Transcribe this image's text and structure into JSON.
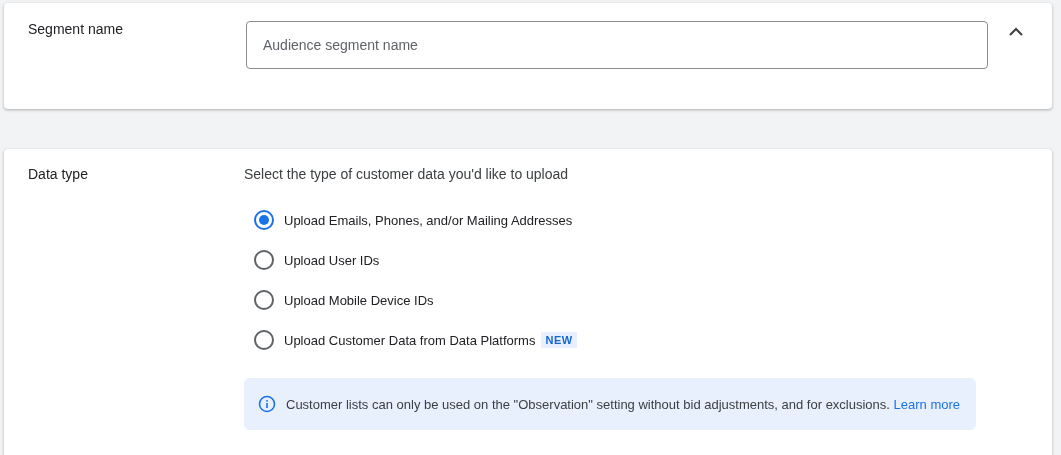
{
  "segment_name": {
    "label": "Segment name",
    "placeholder": "Audience segment name",
    "expanded": true
  },
  "data_type": {
    "label": "Data type",
    "prompt": "Select the type of customer data you'd like to upload",
    "options": [
      {
        "label": "Upload Emails, Phones, and/or Mailing Addresses",
        "selected": true
      },
      {
        "label": "Upload User IDs",
        "selected": false
      },
      {
        "label": "Upload Mobile Device IDs",
        "selected": false
      },
      {
        "label": "Upload Customer Data from Data Platforms",
        "selected": false,
        "badge": "NEW"
      }
    ],
    "notice": {
      "text": "Customer lists can only be used on the \"Observation\" setting without bid adjustments, and for exclusions.",
      "link": "Learn more"
    }
  }
}
